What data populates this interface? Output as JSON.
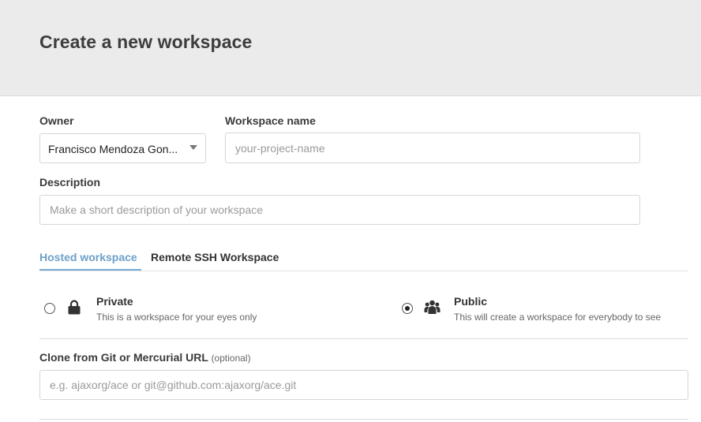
{
  "header": {
    "title": "Create a new workspace"
  },
  "form": {
    "owner": {
      "label": "Owner",
      "value": "Francisco Mendoza Gon..."
    },
    "workspace_name": {
      "label": "Workspace name",
      "placeholder": "your-project-name"
    },
    "description": {
      "label": "Description",
      "placeholder": "Make a short description of your workspace"
    },
    "tabs": [
      {
        "label": "Hosted workspace",
        "active": true
      },
      {
        "label": "Remote SSH Workspace",
        "active": false
      }
    ],
    "visibility": {
      "private": {
        "title": "Private",
        "description": "This is a workspace for your eyes only",
        "selected": false,
        "icon": "lock-icon"
      },
      "public": {
        "title": "Public",
        "description": "This will create a workspace for everybody to see",
        "selected": true,
        "icon": "group-icon"
      }
    },
    "clone": {
      "label": "Clone from Git or Mercurial URL",
      "optional": "(optional)",
      "placeholder": "e.g. ajaxorg/ace or git@github.com:ajaxorg/ace.git"
    }
  },
  "colors": {
    "header_bg": "#ebebeb",
    "active_tab": "#6ea0c8"
  }
}
